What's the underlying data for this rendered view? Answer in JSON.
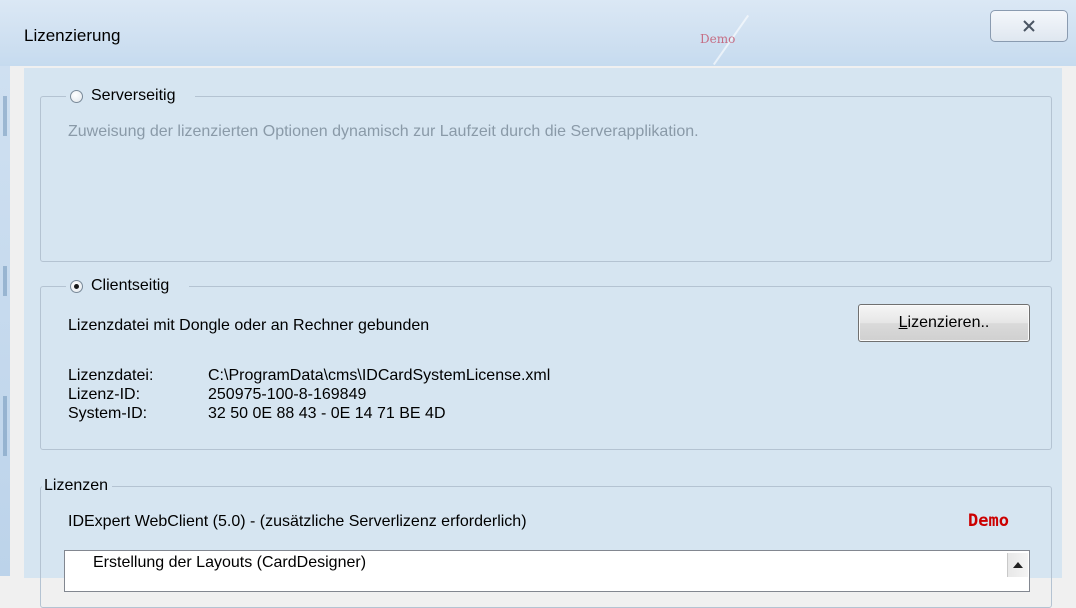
{
  "window": {
    "title": "Lizenzierung",
    "watermark": "Demo"
  },
  "server": {
    "label": "Serverseitig",
    "selected": false,
    "description": "Zuweisung der lizenzierten Optionen dynamisch zur Laufzeit durch die Serverapplikation."
  },
  "client": {
    "label": "Clientseitig",
    "selected": true,
    "description": "Lizenzdatei mit Dongle oder an Rechner gebunden",
    "license_button": "Lizenzieren..",
    "fields": [
      {
        "key": "Lizenzdatei:",
        "value": "C:\\ProgramData\\cms\\IDCardSystemLicense.xml"
      },
      {
        "key": "Lizenz-ID:",
        "value": "250975-100-8-169849"
      },
      {
        "key": "System-ID:",
        "value": "32 50 0E 88 43 - 0E 14 71 BE 4D"
      }
    ]
  },
  "licenses": {
    "label": "Lizenzen",
    "product": "IDExpert WebClient (5.0) - (zusätzliche Serverlizenz erforderlich)",
    "status": "Demo",
    "status_color": "#cc0000",
    "list_items": [
      "Erstellung der Layouts (CardDesigner)"
    ]
  }
}
